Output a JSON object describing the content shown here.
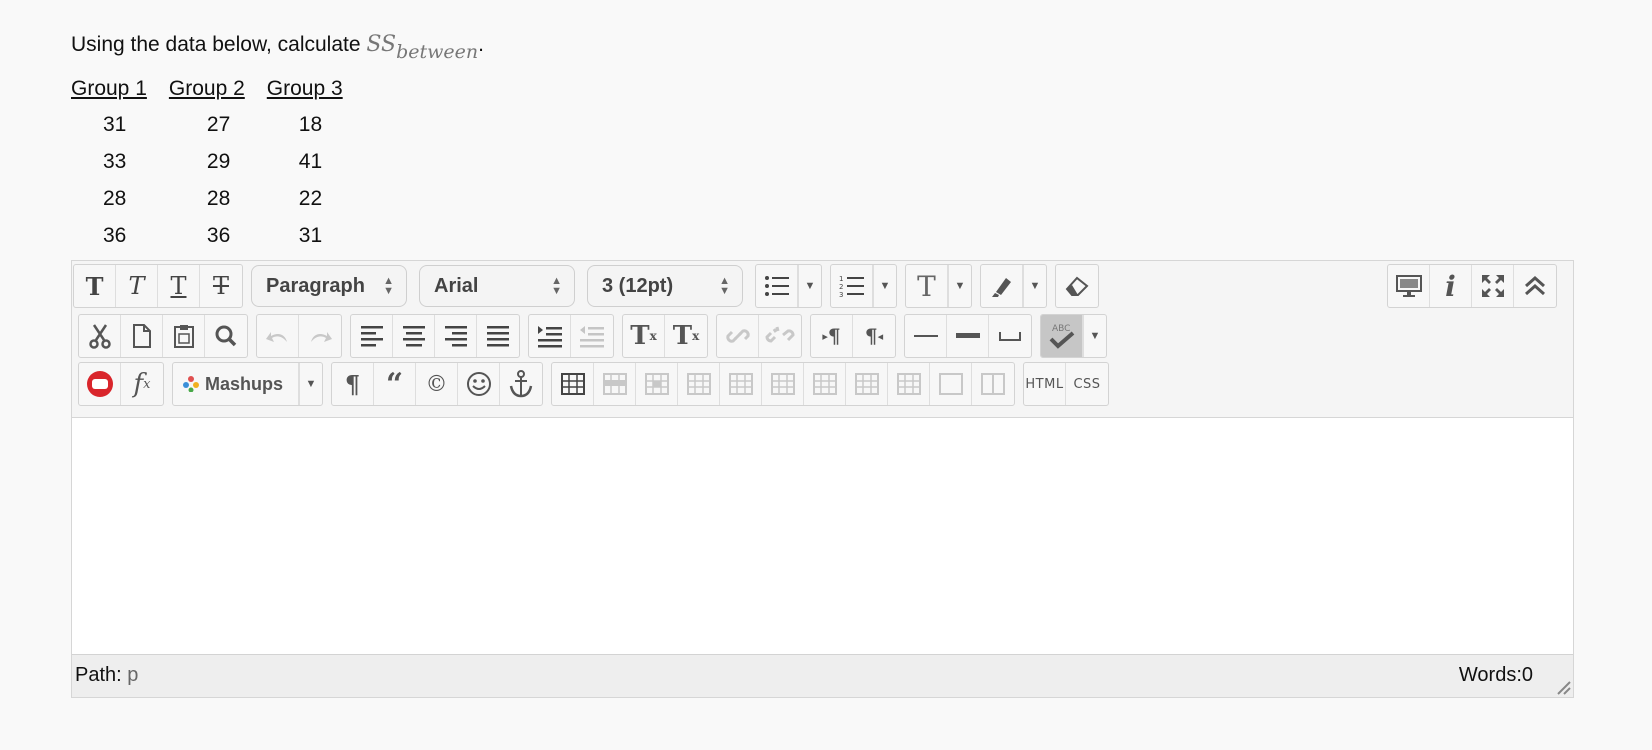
{
  "question": {
    "prefix": "Using the data below, calculate ",
    "math_base": "SS",
    "math_sub": "between",
    "suffix": "."
  },
  "table": {
    "headers": [
      "Group 1",
      "Group 2",
      "Group 3"
    ],
    "rows": [
      [
        "31",
        "27",
        "18"
      ],
      [
        "33",
        "29",
        "41"
      ],
      [
        "28",
        "28",
        "22"
      ],
      [
        "36",
        "36",
        "31"
      ]
    ]
  },
  "toolbar": {
    "paragraph_select": "Paragraph",
    "font_select": "Arial",
    "size_select": "3 (12pt)",
    "mashups_label": "Mashups",
    "html_label": "HTML",
    "css_label": "CSS"
  },
  "status": {
    "path_label": "Path:",
    "path_value": "p",
    "words_label": "Words:0"
  },
  "colors": {
    "background": "#f9f9f9",
    "toolbar": "#f5f5f5",
    "youtube_red": "#d9252b"
  }
}
